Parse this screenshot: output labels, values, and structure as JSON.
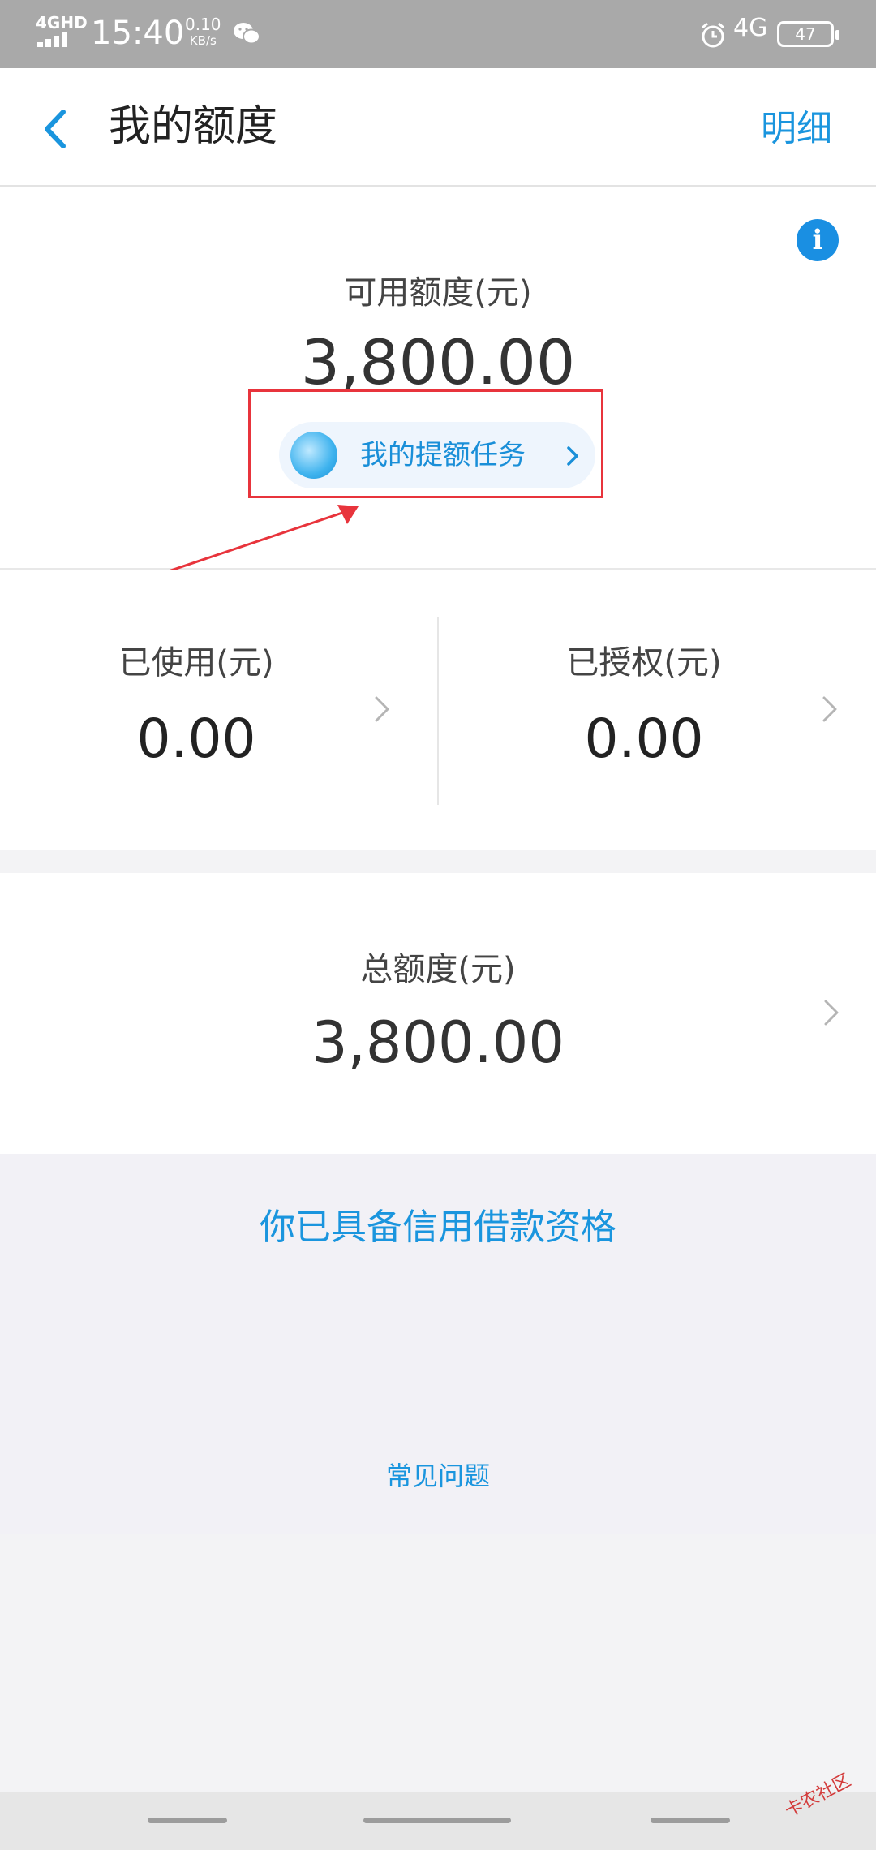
{
  "status_bar": {
    "network_label": "4GHD",
    "time": "15:40",
    "speed_value": "0.10",
    "speed_unit": "KB/s",
    "signal_label": "4G",
    "battery": "47"
  },
  "header": {
    "title": "我的额度",
    "detail_link": "明细"
  },
  "available": {
    "label": "可用额度(元)",
    "amount": "3,800.00",
    "task_button_label": "我的提额任务"
  },
  "used": {
    "label": "已使用(元)",
    "amount": "0.00"
  },
  "authorized": {
    "label": "已授权(元)",
    "amount": "0.00"
  },
  "total": {
    "label": "总额度(元)",
    "amount": "3,800.00"
  },
  "eligibility_text": "你已具备信用借款资格",
  "faq_link": "常见问题",
  "watermark": "卡农社区",
  "colors": {
    "accent_blue": "#1a95de",
    "highlight_red": "#e8343c"
  }
}
